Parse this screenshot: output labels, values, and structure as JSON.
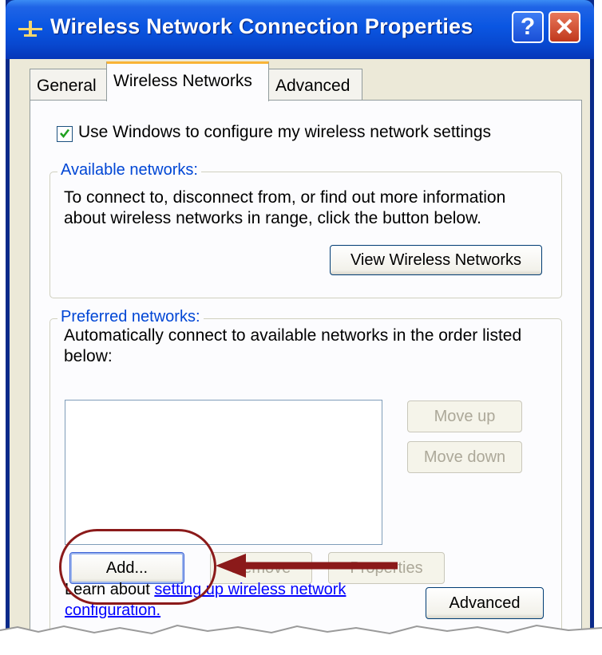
{
  "window": {
    "title": "Wireless Network Connection Properties"
  },
  "titlebar": {
    "help_label": "?",
    "close_label": "✕"
  },
  "tabs": [
    {
      "label": "General"
    },
    {
      "label": "Wireless Networks"
    },
    {
      "label": "Advanced"
    }
  ],
  "checkbox": {
    "label": "Use Windows to configure my wireless network settings",
    "checked": true
  },
  "available": {
    "legend": "Available networks:",
    "line1": "To connect to, disconnect from, or find out more information",
    "line2": "about wireless networks in range, click the button below.",
    "button": "View Wireless Networks"
  },
  "preferred": {
    "legend": "Preferred networks:",
    "line1": "Automatically connect to available networks in the order listed",
    "line2": "below:",
    "move_up": "Move up",
    "move_down": "Move down",
    "add": "Add...",
    "remove": "Remove",
    "properties": "Properties"
  },
  "learn": {
    "prefix": "Learn about ",
    "link_part1": "setting up wireless network",
    "link_part2": "configuration."
  },
  "advanced_button": "Advanced",
  "colors": {
    "title_blue": "#0a56e2",
    "accent_orange": "#f8b337",
    "annotation_red": "#8b1a1a",
    "legend_blue": "#0046d5"
  }
}
